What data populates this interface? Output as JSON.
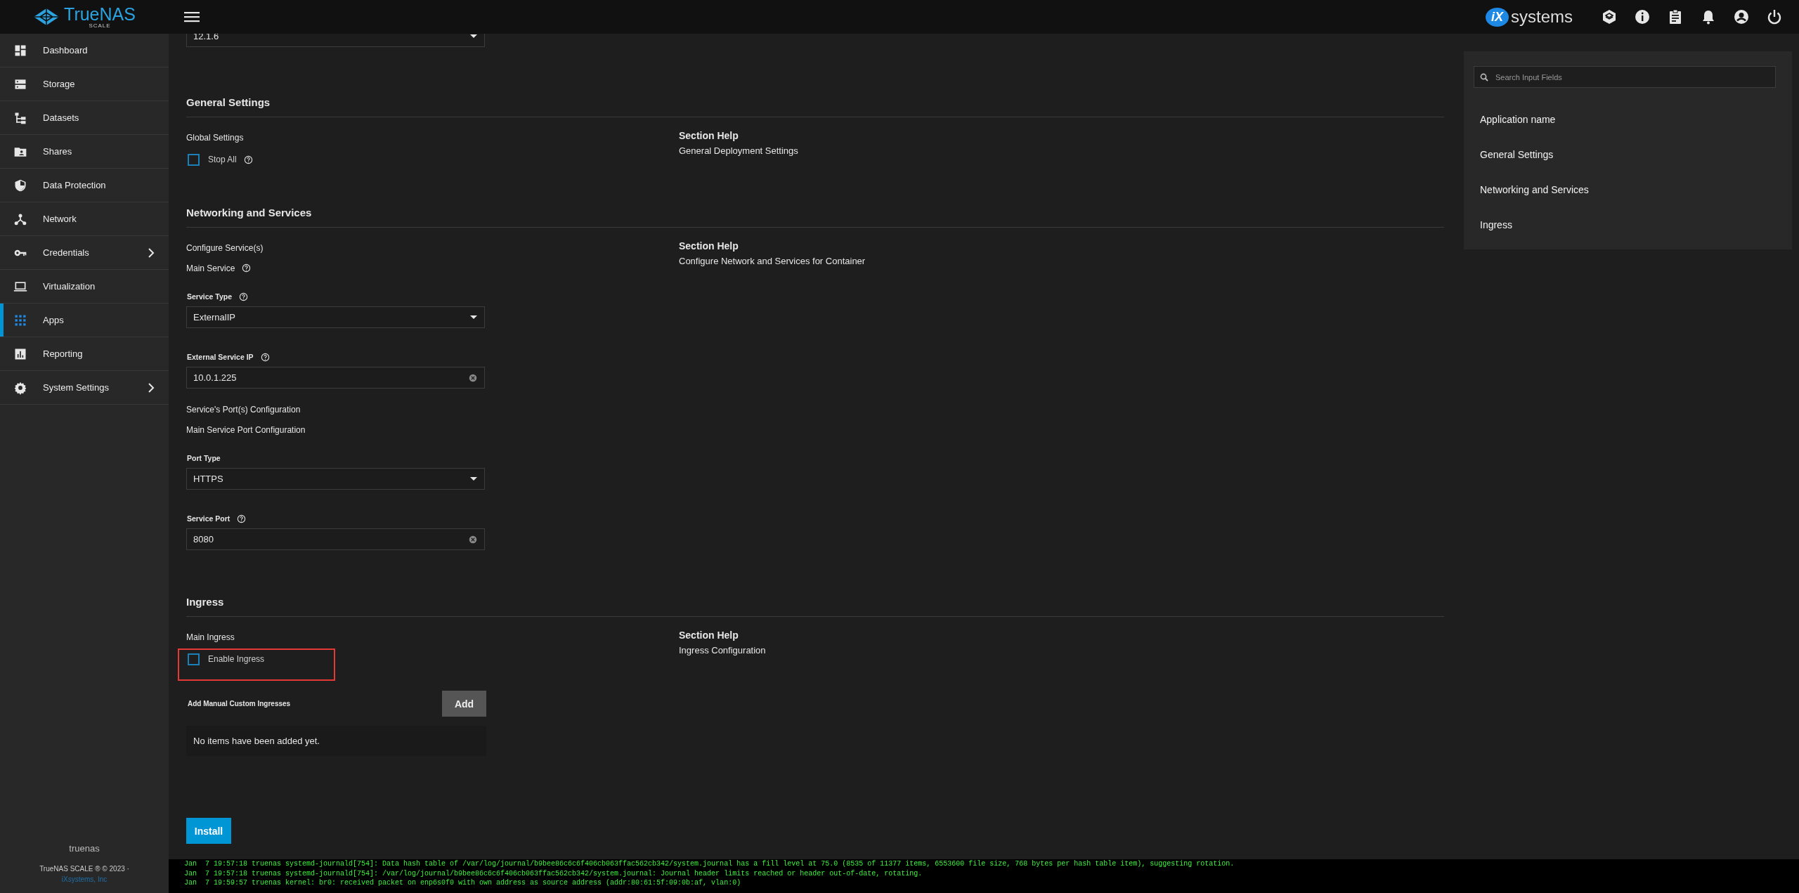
{
  "header": {
    "logo": {
      "name": "TrueNAS",
      "edition": "SCALE"
    },
    "brand": {
      "mark": "iX",
      "name": "systems"
    }
  },
  "sidebar": {
    "items": [
      {
        "label": "Dashboard",
        "selected": false,
        "expandable": false
      },
      {
        "label": "Storage",
        "selected": false,
        "expandable": false
      },
      {
        "label": "Datasets",
        "selected": false,
        "expandable": false
      },
      {
        "label": "Shares",
        "selected": false,
        "expandable": false
      },
      {
        "label": "Data Protection",
        "selected": false,
        "expandable": false
      },
      {
        "label": "Network",
        "selected": false,
        "expandable": false
      },
      {
        "label": "Credentials",
        "selected": false,
        "expandable": true
      },
      {
        "label": "Virtualization",
        "selected": false,
        "expandable": false
      },
      {
        "label": "Apps",
        "selected": true,
        "expandable": false
      },
      {
        "label": "Reporting",
        "selected": false,
        "expandable": false
      },
      {
        "label": "System Settings",
        "selected": false,
        "expandable": true
      }
    ],
    "hostname": "truenas",
    "copyright": "TrueNAS SCALE ® © 2023 ·",
    "company": "iXsystems, Inc"
  },
  "form": {
    "top_select": {
      "value": "12.1.6"
    },
    "sections": [
      {
        "title": "General Settings",
        "help_title": "Section Help",
        "help_text": "General Deployment Settings",
        "fields": [
          {
            "kind": "group",
            "label": "Global Settings",
            "help": false
          },
          {
            "kind": "checkbox",
            "label": "Stop All",
            "help": true,
            "checked": false,
            "highlighted": false
          }
        ]
      },
      {
        "title": "Networking and Services",
        "help_title": "Section Help",
        "help_text": "Configure Network and Services for Container",
        "fields": [
          {
            "kind": "group",
            "label": "Configure Service(s)",
            "help": false
          },
          {
            "kind": "group",
            "label": "Main Service",
            "help": true
          },
          {
            "kind": "select",
            "label": "Service Type",
            "help": true,
            "value": "ExternalIP"
          },
          {
            "kind": "input",
            "label": "External Service IP",
            "help": true,
            "value": "10.0.1.225"
          },
          {
            "kind": "group",
            "label": "Service's Port(s) Configuration",
            "help": false
          },
          {
            "kind": "group",
            "label": "Main Service Port Configuration",
            "help": false
          },
          {
            "kind": "select",
            "label": "Port Type",
            "help": false,
            "value": "HTTPS"
          },
          {
            "kind": "input",
            "label": "Service Port",
            "help": true,
            "value": "8080"
          }
        ]
      },
      {
        "title": "Ingress",
        "help_title": "Section Help",
        "help_text": "Ingress Configuration",
        "fields": [
          {
            "kind": "group",
            "label": "Main Ingress",
            "help": false
          },
          {
            "kind": "checkbox",
            "label": "Enable Ingress",
            "help": false,
            "checked": false,
            "highlighted": true
          },
          {
            "kind": "list",
            "label": "Add Manual Custom Ingresses",
            "button": "Add",
            "empty": "No items have been added yet."
          }
        ]
      }
    ],
    "install_button": "Install"
  },
  "help_panel": {
    "search": {
      "placeholder": "Search Input Fields"
    },
    "items": [
      "Application name",
      "General Settings",
      "Networking and Services",
      "Ingress"
    ]
  },
  "console": {
    "lines": [
      "Jan  7 19:57:18 truenas systemd-journald[754]: Data hash table of /var/log/journal/b9bee86c6c6f406cb063ffac562cb342/system.journal has a fill level at 75.0 (8535 of 11377 items, 6553600 file size, 768 bytes per hash table item), suggesting rotation.",
      "Jan  7 19:57:18 truenas systemd-journald[754]: /var/log/journal/b9bee86c6c6f406cb063ffac562cb342/system.journal: Journal header limits reached or header out-of-date, rotating.",
      "Jan  7 19:59:57 truenas kernel: br0: received packet on enp6s0f0 with own address as source address (addr:80:61:5f:09:0b:af, vlan:0)"
    ]
  }
}
